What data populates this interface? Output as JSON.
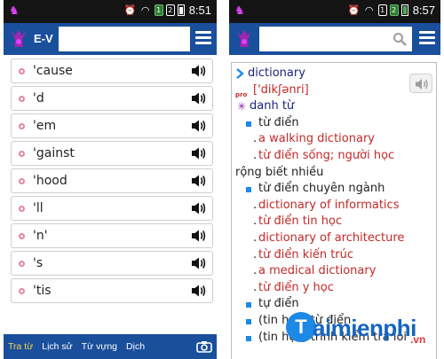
{
  "colors": {
    "accent": "#1a4f9c",
    "active_tab": "#ffd54f",
    "example_red": "#c62828",
    "headword_blue": "#1a237e",
    "bullet_pink": "#e5869b"
  },
  "left": {
    "status": {
      "time": "8:51",
      "icons": [
        "alarm-icon",
        "wifi-icon",
        "sim1-icon",
        "sim2-icon",
        "battery-icon"
      ]
    },
    "appbar": {
      "label": "E-V",
      "search_value": "",
      "search_placeholder": ""
    },
    "words": [
      "'cause",
      "'d",
      "'em",
      "'gainst",
      "'hood",
      "'ll",
      "'n'",
      "'s",
      "'tis"
    ],
    "tabs": [
      {
        "label": "Tra từ",
        "active": true
      },
      {
        "label": "Lịch sử",
        "active": false
      },
      {
        "label": "Từ vựng",
        "active": false
      },
      {
        "label": "Dịch",
        "active": false
      }
    ]
  },
  "right": {
    "status": {
      "time": "8:57"
    },
    "search_value": "",
    "entry": {
      "headword": "dictionary",
      "phonetic": "['dikʃənri]",
      "pos": "danh từ",
      "lines": [
        {
          "kind": "sense",
          "text": "từ điển"
        },
        {
          "kind": "ex",
          "text": "a walking dictionary"
        },
        {
          "kind": "ex",
          "text": "từ điển sống; người học"
        },
        {
          "kind": "cont",
          "text": "rộng biết nhiều"
        },
        {
          "kind": "sense",
          "text": "từ điển chuyên ngành"
        },
        {
          "kind": "ex",
          "text": "dictionary of informatics"
        },
        {
          "kind": "ex",
          "text": "từ điển tin học"
        },
        {
          "kind": "ex",
          "text": "dictionary of architecture"
        },
        {
          "kind": "ex",
          "text": "từ điển kiến trúc"
        },
        {
          "kind": "ex",
          "text": "a medical dictionary"
        },
        {
          "kind": "ex",
          "text": "từ điển y học"
        },
        {
          "kind": "sense",
          "text": "tự điển"
        },
        {
          "kind": "sense",
          "text": "(tin học) từ điển"
        },
        {
          "kind": "sense",
          "text": "(tin học) trình kiểm tra lỗi"
        }
      ]
    }
  },
  "watermark": {
    "letter": "T",
    "text": "aimienphi",
    "suffix": ".vn"
  }
}
